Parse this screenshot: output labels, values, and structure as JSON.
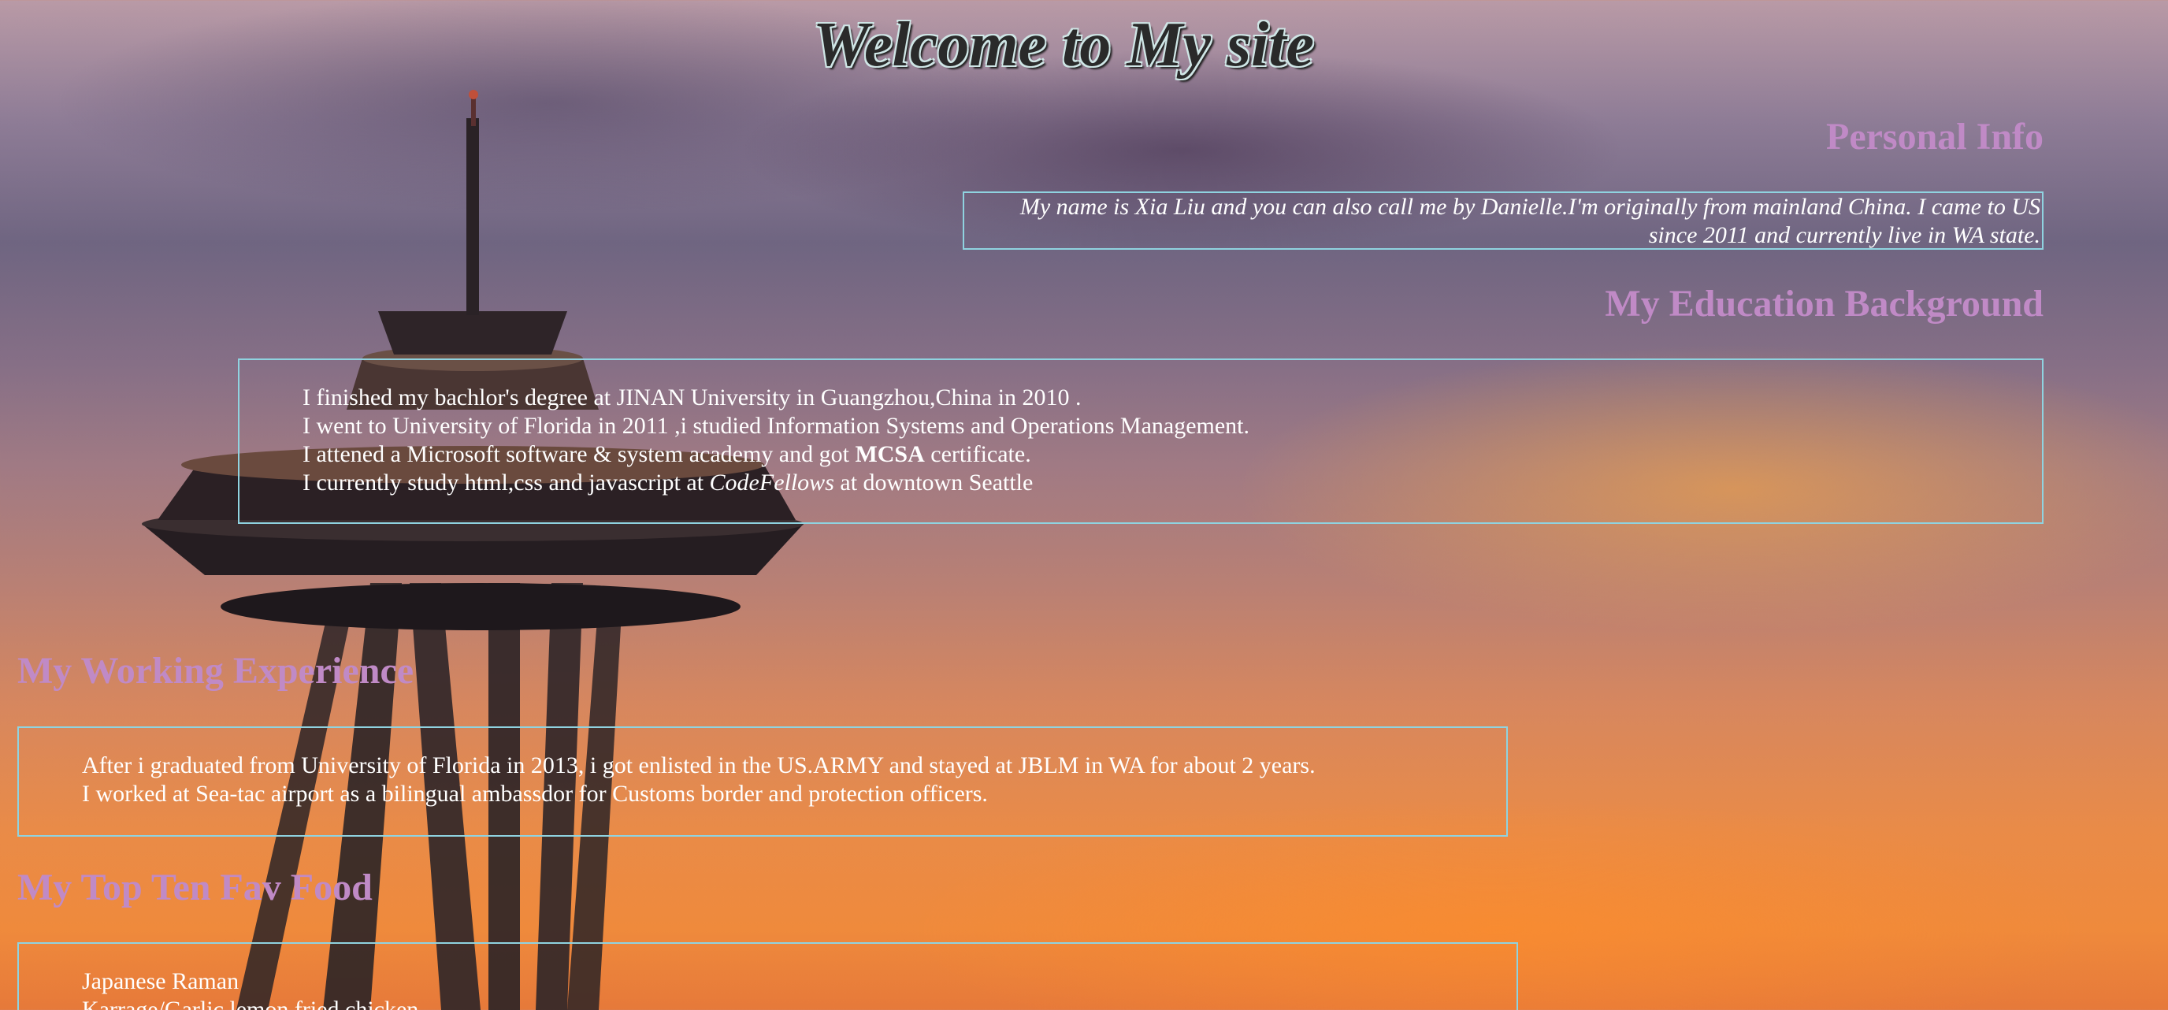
{
  "page": {
    "title": "Welcome to My site"
  },
  "personal": {
    "heading": "Personal Info",
    "text": "My name is Xia Liu and you can also call me by Danielle.I'm originally from mainland China. I came to US since 2011 and currently live in WA state."
  },
  "education": {
    "heading": "My Education Background",
    "line1": "I finished my bachlor's degree at JINAN University in Guangzhou,China in 2010 .",
    "line2": "I went to University of Florida in 2011 ,i studied Information Systems and Operations Management.",
    "line3_pre": "I attened a Microsoft software & system academy and got ",
    "line3_bold": "MCSA",
    "line3_post": " certificate.",
    "line4_pre": "I currently study html,css and javascript at ",
    "line4_italic": "CodeFellows",
    "line4_post": " at downtown Seattle"
  },
  "work": {
    "heading": "My Working Experience",
    "line1": "After i graduated from University of Florida in 2013, i got enlisted in the US.ARMY and stayed at JBLM in WA for about 2 years.",
    "line2": "I worked at Sea-tac airport as a bilingual ambassdor for Customs border and protection officers."
  },
  "food": {
    "heading": "My Top Ten Fav Food",
    "items": [
      "Japanese Raman",
      "Karrage/Garlic lemon fried chicken"
    ]
  },
  "colors": {
    "heading": "#c08ac6",
    "border": "#8fd3e0",
    "text": "#ffffff"
  }
}
